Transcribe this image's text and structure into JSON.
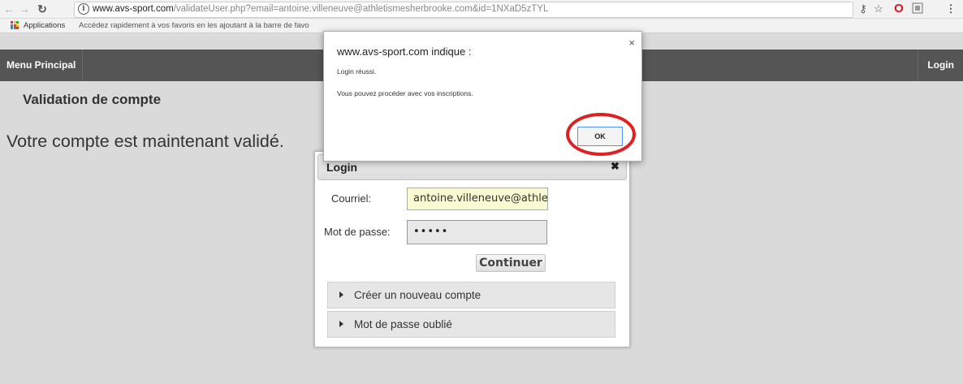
{
  "browser": {
    "url_host": "www.avs-sport.com",
    "url_rest": "/validateUser.php?email=antoine.villeneuve@athletismesherbrooke.com&id=1NXaD5zTYL",
    "back_icon": "arrow-left-icon",
    "forward_icon": "arrow-right-icon",
    "reload_icon": "reload-icon",
    "star_icon": "star-icon"
  },
  "bookmarks": {
    "apps_label": "Applications",
    "hint": "Accédez rapidement à vos favoris en les ajoutant à la barre de favo"
  },
  "nav": {
    "menu_label": "Menu Principal",
    "login_label": "Login"
  },
  "page": {
    "title": "Validation de compte",
    "message": "Votre compte est maintenant validé."
  },
  "login_dialog": {
    "title": "Login",
    "email_label": "Courriel:",
    "email_value": "antoine.villeneuve@athletis",
    "password_label": "Mot de passe:",
    "password_value": "•••••",
    "continue_label": "Continuer",
    "create_account": "Créer un nouveau compte",
    "forgot_password": "Mot de passe oublié"
  },
  "alert": {
    "origin": "www.avs-sport.com indique :",
    "message1": "Login réussi.",
    "message2": "Vous pouvez procéder avec vos inscriptions.",
    "ok_label": "OK"
  },
  "colors": {
    "nav_bg": "#555555",
    "highlight_circle": "#e02020",
    "email_field_bg": "#fafad2"
  }
}
